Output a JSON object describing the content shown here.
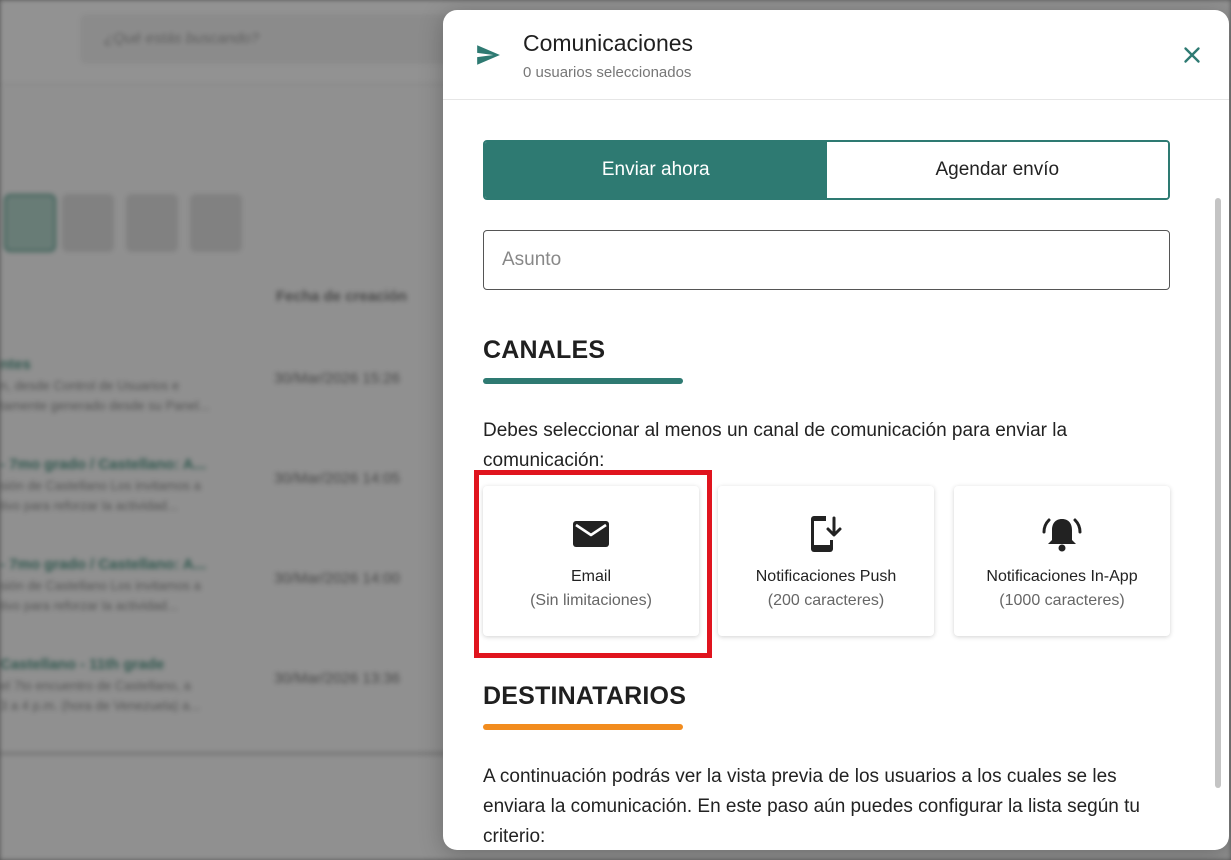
{
  "background": {
    "search_placeholder": "¿Qué estás buscando?",
    "column_header": "Fecha de creación",
    "rows": [
      {
        "title": "ntes",
        "line1": "n, desde Control de Usuarios e",
        "line2": "tamente generado desde su Panel...",
        "date": "30/Mar/2026 15:26"
      },
      {
        "title": "- 7mo grado / Castellano: A...",
        "line1": "sión de Castellano Los invitamos a",
        "line2": "tivo para reforzar la actividad...",
        "date": "30/Mar/2026 14:05"
      },
      {
        "title": "- 7mo grado / Castellano: A...",
        "line1": "sión de Castellano Los invitamos a",
        "line2": "tivo para reforzar la actividad...",
        "date": "30/Mar/2026 14:00"
      },
      {
        "title": "Castellano - 11th grade",
        "line1": "el 7to encuentro de Castellano, a",
        "line2": "3 a 4 p.m. (hora de Venezuela) a...",
        "date": "30/Mar/2026 13:36"
      }
    ]
  },
  "modal": {
    "title": "Comunicaciones",
    "subtitle": "0 usuarios seleccionados",
    "icons": {
      "send": "send-icon",
      "close": "close-icon"
    },
    "tabs": [
      {
        "label": "Enviar ahora",
        "active": true
      },
      {
        "label": "Agendar envío",
        "active": false
      }
    ],
    "subject": {
      "placeholder": "Asunto",
      "value": ""
    },
    "channels": {
      "title": "CANALES",
      "description": "Debes seleccionar al menos un canal de comunicación para enviar la comunicación:",
      "items": [
        {
          "name": "Email",
          "limit": "(Sin limitaciones)",
          "icon": "mail-icon"
        },
        {
          "name": "Notificaciones Push",
          "limit": "(200 caracteres)",
          "icon": "phone-download-icon"
        },
        {
          "name": "Notificaciones In-App",
          "limit": "(1000 caracteres)",
          "icon": "bell-ring-icon"
        }
      ]
    },
    "recipients": {
      "title": "DESTINATARIOS",
      "description": "A continuación podrás ver la vista previa de los usuarios a los cuales se les enviara la comunicación. En este paso aún puedes configurar la lista según tu criterio:"
    }
  },
  "colors": {
    "primary": "#2e7a72",
    "accent_orange": "#f28c1e",
    "highlight_red": "#e0141e"
  }
}
